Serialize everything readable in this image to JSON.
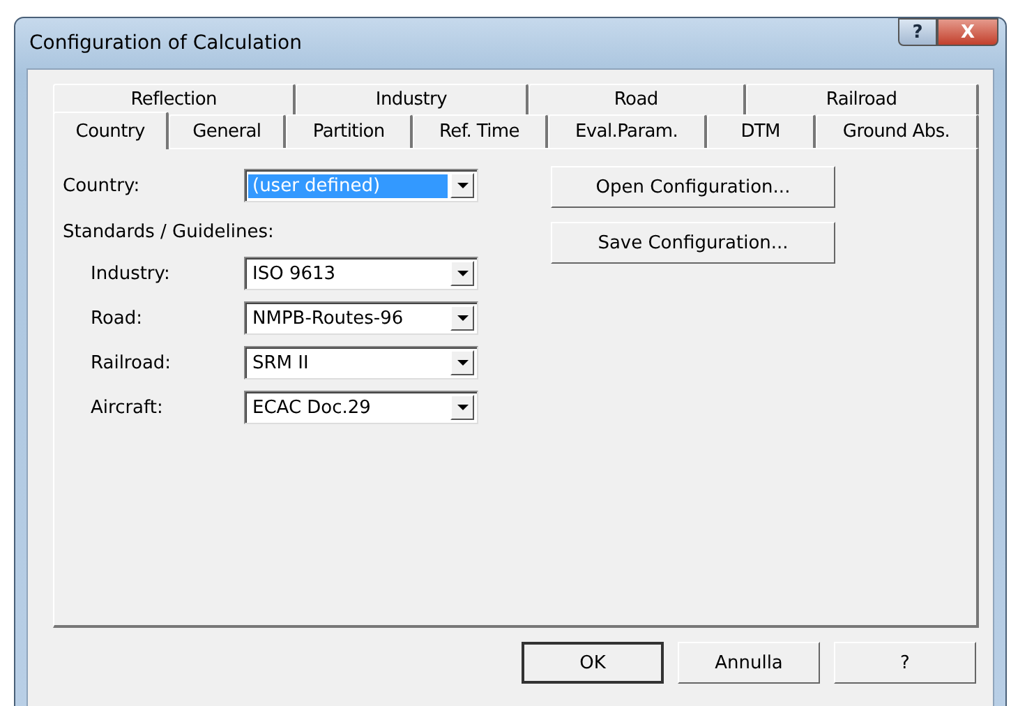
{
  "window": {
    "title": "Configuration of Calculation",
    "title_buttons": [
      "?",
      "X"
    ]
  },
  "tab_rows": [
    [
      {
        "label": "Reflection",
        "selected": false
      },
      {
        "label": "Industry",
        "selected": false
      },
      {
        "label": "Road",
        "selected": false
      },
      {
        "label": "Railroad",
        "selected": false
      }
    ],
    [
      {
        "label": "Country",
        "selected": true
      },
      {
        "label": "General",
        "selected": false
      },
      {
        "label": "Partition",
        "selected": false
      },
      {
        "label": "Ref. Time",
        "selected": false
      },
      {
        "label": "Eval.Param.",
        "selected": false
      },
      {
        "label": "DTM",
        "selected": false
      },
      {
        "label": "Ground Abs.",
        "selected": false
      }
    ]
  ],
  "country": {
    "label": "Country:",
    "value": "(user defined)",
    "highlighted": true
  },
  "standards": {
    "heading": "Standards / Guidelines:",
    "fields": [
      {
        "label": "Industry:",
        "value": "ISO 9613",
        "highlighted": false
      },
      {
        "label": "Road:",
        "value": "NMPB-Routes-96",
        "highlighted": false
      },
      {
        "label": "Railroad:",
        "value": "SRM II",
        "highlighted": false
      },
      {
        "label": "Aircraft:",
        "value": "ECAC Doc.29",
        "highlighted": false
      }
    ]
  },
  "side_buttons": [
    "Open Configuration...",
    "Save Configuration..."
  ],
  "dialog_buttons": [
    {
      "label": "OK",
      "default": true
    },
    {
      "label": "Annulla",
      "default": false
    },
    {
      "label": "?",
      "default": false
    }
  ]
}
